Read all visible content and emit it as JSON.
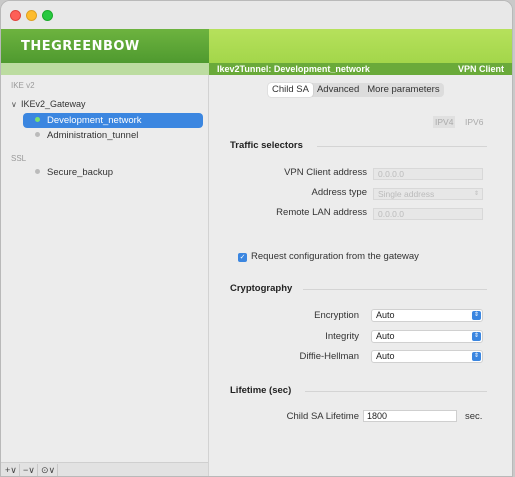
{
  "brand": {
    "logo_text": "THEGREENBOW"
  },
  "header": {
    "tunnel_title": "Ikev2Tunnel: Development_network",
    "product": "VPN Client"
  },
  "sidebar": {
    "ike_section": "IKE v2",
    "gateway": "IKEv2_Gateway",
    "items": [
      {
        "label": "Development_network",
        "selected": true,
        "status": "green"
      },
      {
        "label": "Administration_tunnel",
        "selected": false,
        "status": "gray"
      }
    ],
    "ssl_section": "SSL",
    "ssl_items": [
      {
        "label": "Secure_backup",
        "status": "gray"
      }
    ],
    "footer": {
      "add": "+∨",
      "remove": "−∨",
      "more": "⊙∨"
    }
  },
  "tabs": [
    {
      "label": "Child SA",
      "active": true
    },
    {
      "label": "Advanced",
      "active": false
    },
    {
      "label": "More parameters",
      "active": false
    }
  ],
  "ip_toggle": {
    "ipv4": "IPV4",
    "ipv6": "IPV6"
  },
  "traffic": {
    "title": "Traffic selectors",
    "client_address_label": "VPN Client address",
    "client_address_value": "0.0.0.0",
    "address_type_label": "Address type",
    "address_type_value": "Single address",
    "remote_lan_label": "Remote LAN address",
    "remote_lan_value": "0.0.0.0"
  },
  "request_config": {
    "label": "Request configuration from the gateway",
    "checked": true
  },
  "crypto": {
    "title": "Cryptography",
    "encryption_label": "Encryption",
    "encryption_value": "Auto",
    "integrity_label": "Integrity",
    "integrity_value": "Auto",
    "dh_label": "Diffie-Hellman",
    "dh_value": "Auto"
  },
  "lifetime": {
    "title": "Lifetime (sec)",
    "child_label": "Child SA Lifetime",
    "child_value": "1800",
    "unit": "sec."
  },
  "colors": {
    "accent": "#3b86e0",
    "brand_green": "#6aaa3a",
    "banner_light": "#a3d64a"
  }
}
